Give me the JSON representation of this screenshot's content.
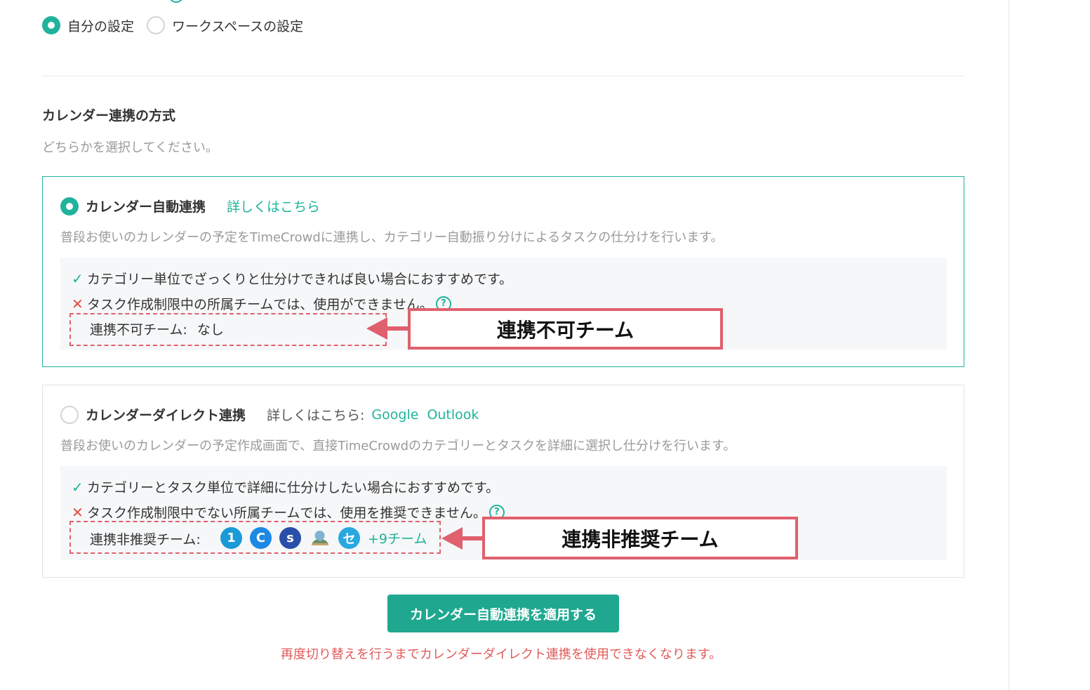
{
  "scope": {
    "options": [
      {
        "label": "自分の設定",
        "selected": true
      },
      {
        "label": "ワークスペースの設定",
        "selected": false
      }
    ]
  },
  "section": {
    "title": "カレンダー連携の方式",
    "subtitle": "どちらかを選択してください。"
  },
  "auto_option": {
    "title": "カレンダー自動連携",
    "link": "詳しくはこちら",
    "description": "普段お使いのカレンダーの予定をTimeCrowdに連携し、カテゴリー自動振り分けによるタスクの仕分けを行います。",
    "pro": "カテゴリー単位でざっくりと仕分けできれば良い場合におすすめです。",
    "con": "タスク作成制限中の所属チームでは、使用ができません。",
    "help_glyph": "?",
    "team_label": "連携不可チーム:",
    "team_value": "なし",
    "selected": true
  },
  "direct_option": {
    "title": "カレンダーダイレクト連携",
    "link_prefix": "詳しくはこちら:",
    "link_google": "Google",
    "link_outlook": "Outlook",
    "description": "普段お使いのカレンダーの予定作成画面で、直接TimeCrowdのカテゴリーとタスクを詳細に選択し仕分けを行います。",
    "pro": "カテゴリーとタスク単位で詳細に仕分けしたい場合におすすめです。",
    "con": "タスク作成制限中でない所属チームでは、使用を推奨できません。",
    "help_glyph": "?",
    "team_label": "連携非推奨チーム:",
    "teams": [
      {
        "glyph": "1",
        "color": "#1a9ad6"
      },
      {
        "glyph": "C",
        "color": "#1e88e5"
      },
      {
        "glyph": "s",
        "color": "#2a4fa8"
      },
      {
        "glyph": "",
        "color": "#6b8f6b"
      },
      {
        "glyph": "セ",
        "color": "#29a8e0"
      }
    ],
    "more_teams": "+9チーム",
    "selected": false
  },
  "callouts": {
    "auto": "連携不可チーム",
    "direct": "連携非推奨チーム"
  },
  "apply_button": "カレンダー自動連携を適用する",
  "warning": "再度切り替えを行うまでカレンダーダイレクト連携を使用できなくなります。",
  "colors": {
    "accent": "#1fb39c",
    "annotation": "#e0606e",
    "error": "#e05a5a"
  }
}
